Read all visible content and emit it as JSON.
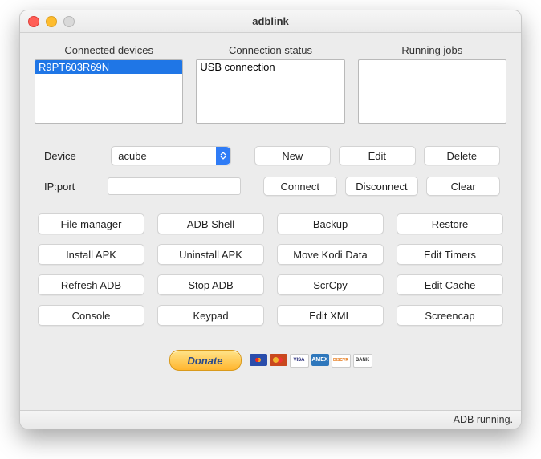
{
  "window": {
    "title": "adblink"
  },
  "panels": {
    "devices": {
      "label": "Connected devices",
      "items": [
        "R9PT603R69N"
      ],
      "selected": 0
    },
    "status": {
      "label": "Connection status",
      "items": [
        "USB connection"
      ]
    },
    "jobs": {
      "label": "Running jobs",
      "items": []
    }
  },
  "device_row": {
    "label": "Device",
    "select_value": "acube",
    "new": "New",
    "edit": "Edit",
    "delete": "Delete"
  },
  "ip_row": {
    "label": "IP:port",
    "value": "",
    "connect": "Connect",
    "disconnect": "Disconnect",
    "clear": "Clear"
  },
  "actions": {
    "file_manager": "File manager",
    "adb_shell": "ADB Shell",
    "backup": "Backup",
    "restore": "Restore",
    "install_apk": "Install APK",
    "uninstall_apk": "Uninstall APK",
    "move_kodi": "Move Kodi Data",
    "edit_timers": "Edit Timers",
    "refresh_adb": "Refresh ADB",
    "stop_adb": "Stop ADB",
    "scrcpy": "ScrCpy",
    "edit_cache": "Edit Cache",
    "console": "Console",
    "keypad": "Keypad",
    "edit_xml": "Edit XML",
    "screencap": "Screencap"
  },
  "donate": {
    "label": "Donate",
    "cards": [
      "maestro",
      "mc",
      "visa",
      "amex",
      "disc",
      "bank"
    ],
    "card_text": {
      "visa": "VISA",
      "amex": "AMEX",
      "disc": "DISCVR",
      "bank": "BANK"
    }
  },
  "statusbar": {
    "text": "ADB running."
  }
}
